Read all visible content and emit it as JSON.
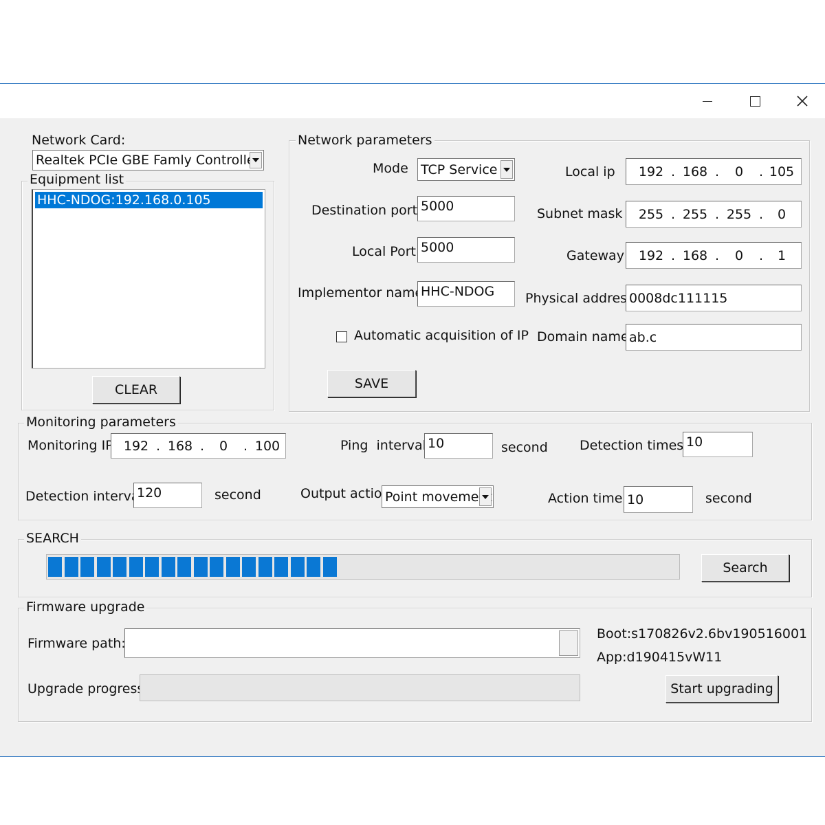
{
  "window": {
    "minimize": "—",
    "maximize": "☐",
    "close": "✕"
  },
  "network_card": {
    "label": "Network Card:",
    "selected": "Realtek PCIe GBE Famly Controller",
    "equipment_list_label": "Equipment list",
    "equipment_items": [
      "HHC-NDOG:192.168.0.105"
    ],
    "clear_button": "CLEAR"
  },
  "network_params": {
    "title": "Network parameters",
    "mode_label": "Mode",
    "mode_value": "TCP Service",
    "dest_port_label": "Destination port",
    "dest_port_value": "5000",
    "local_port_label": "Local Port",
    "local_port_value": "5000",
    "implementor_label": "Implementor name",
    "implementor_value": "HHC-NDOG",
    "auto_ip_label": "Automatic acquisition of IP",
    "auto_ip_checked": false,
    "local_ip_label": "Local ip",
    "local_ip": [
      "192",
      "168",
      "0",
      "105"
    ],
    "subnet_label": "Subnet mask",
    "subnet": [
      "255",
      "255",
      "255",
      "0"
    ],
    "gateway_label": "Gateway",
    "gateway": [
      "192",
      "168",
      "0",
      "1"
    ],
    "physical_label": "Physical address",
    "physical_value": "0008dc111115",
    "domain_label": "Domain name",
    "domain_value": "ab.c",
    "save_button": "SAVE"
  },
  "monitoring": {
    "title": "Monitoring parameters",
    "ip_label": "Monitoring IP",
    "ip": [
      "192",
      "168",
      "0",
      "100"
    ],
    "ping_label": "Ping  interval",
    "ping_value": "10",
    "ping_unit": "second",
    "detect_times_label": "Detection times",
    "detect_times_value": "10",
    "detect_interval_label": "Detection interval",
    "detect_interval_value": "120",
    "detect_interval_unit": "second",
    "output_label": "Output action",
    "output_value": "Point movement",
    "action_time_label": "Action time",
    "action_time_value": "10",
    "action_time_unit": "second"
  },
  "search": {
    "title": "SEARCH",
    "progress_segments_filled": 18,
    "progress_fraction": 0.46,
    "search_button": "Search"
  },
  "firmware": {
    "title": "Firmware upgrade",
    "path_label": "Firmware path:",
    "path_value": "",
    "progress_label": "Upgrade progress:",
    "boot_version": "Boot:s170826v2.6bv190516001",
    "app_version": "App:d190415vW11",
    "upgrade_button": "Start upgrading"
  }
}
